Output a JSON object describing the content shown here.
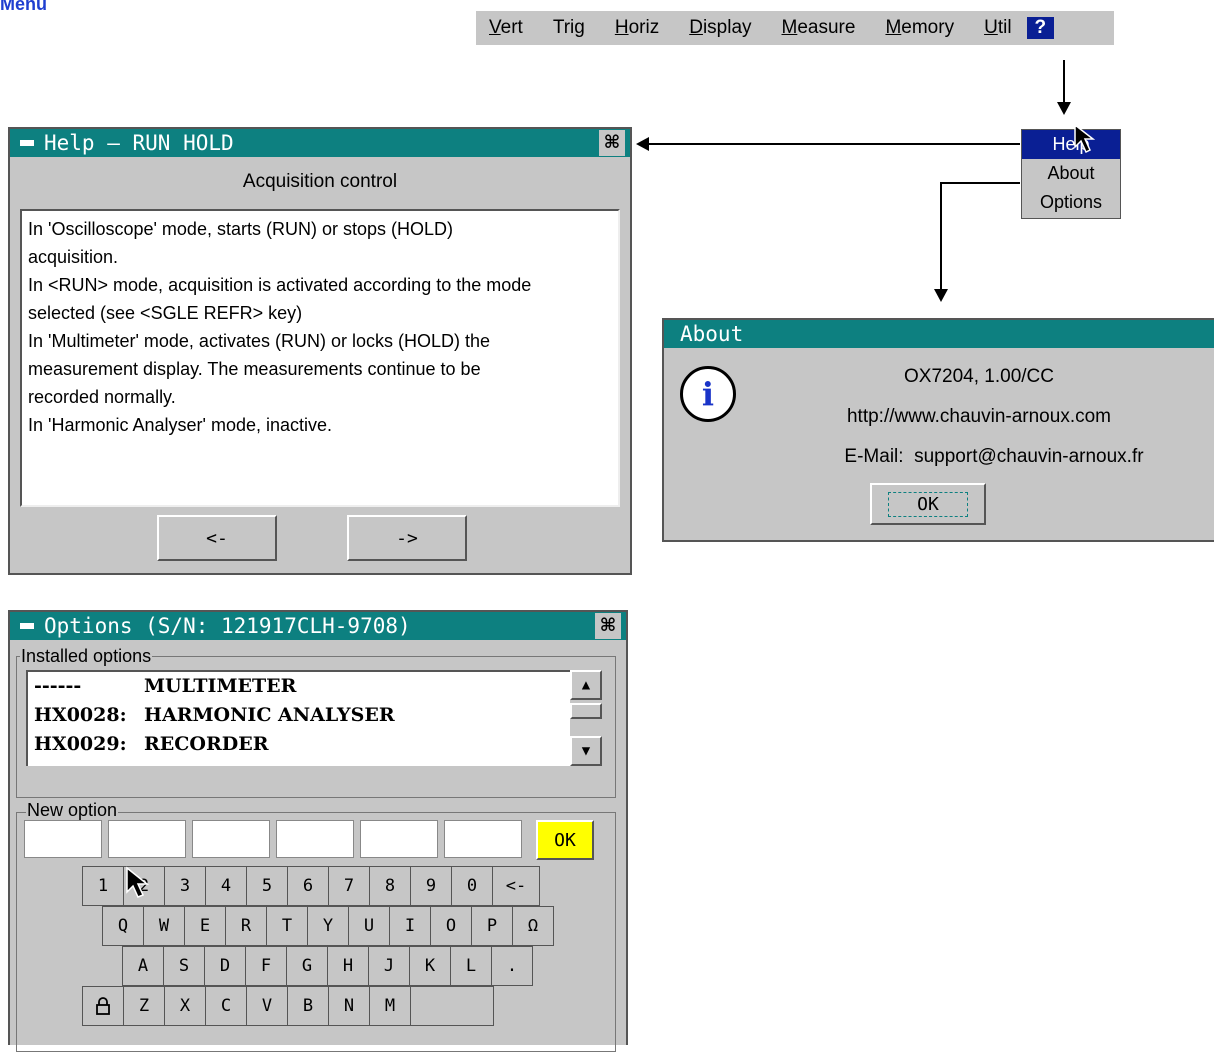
{
  "page_heading": "Menu",
  "menubar": {
    "items": [
      {
        "label": "Vert",
        "u": "V",
        "rest": "ert"
      },
      {
        "label": "Trig",
        "u": "",
        "rest": "Trig"
      },
      {
        "label": "Horiz",
        "u": "H",
        "rest": "oriz"
      },
      {
        "label": "Display",
        "u": "D",
        "rest": "isplay"
      },
      {
        "label": "Measure",
        "u": "M",
        "rest": "easure"
      },
      {
        "label": "Memory",
        "u": "M",
        "rest": "emory"
      },
      {
        "label": "Util",
        "u": "U",
        "rest": "til"
      }
    ],
    "help_label": "?"
  },
  "context_menu": {
    "items": [
      "Help",
      "About",
      "Options"
    ]
  },
  "help_window": {
    "title": "Help – RUN HOLD",
    "subtitle": "Acquisition control",
    "lines": [
      "In 'Oscilloscope' mode, starts (RUN) or stops (HOLD)",
      "acquisition.",
      "In <RUN> mode, acquisition is activated according to the mode",
      "selected (see <SGLE REFR> key)",
      "In 'Multimeter' mode, activates (RUN) or locks (HOLD) the",
      "measurement display. The measurements continue to be",
      "recorded normally.",
      "In 'Harmonic Analyser' mode, inactive."
    ],
    "prev_label": "<-",
    "next_label": "->"
  },
  "about_window": {
    "title": "About",
    "model": "OX7204, 1.00/CC",
    "url": "http://www.chauvin-arnoux.com",
    "email_label": "E-Mail:",
    "email": "support@chauvin-arnoux.fr",
    "ok_label": "OK"
  },
  "options_window": {
    "title": "Options (S/N: 121917CLH-9708)",
    "installed_label": "Installed options",
    "installed": [
      {
        "code": "------",
        "name": "MULTIMETER"
      },
      {
        "code": "HX0028:",
        "name": "HARMONIC ANALYSER"
      },
      {
        "code": "HX0029:",
        "name": "RECORDER"
      }
    ],
    "new_option_label": "New option",
    "ok_label": "OK",
    "keyboard_rows": [
      [
        "1",
        "2",
        "3",
        "4",
        "5",
        "6",
        "7",
        "8",
        "9",
        "0",
        "<-"
      ],
      [
        "Q",
        "W",
        "E",
        "R",
        "T",
        "Y",
        "U",
        "I",
        "O",
        "P",
        "Ω"
      ],
      [
        "A",
        "S",
        "D",
        "F",
        "G",
        "H",
        "J",
        "K",
        "L",
        "."
      ],
      [
        "",
        "Z",
        "X",
        "C",
        "V",
        "B",
        "N",
        "M"
      ]
    ]
  },
  "colors": {
    "title_bar": "#0d8080",
    "menu_highlight": "#0a1f94",
    "ok_highlight": "#ffff00",
    "heading": "#1f3fd0"
  }
}
